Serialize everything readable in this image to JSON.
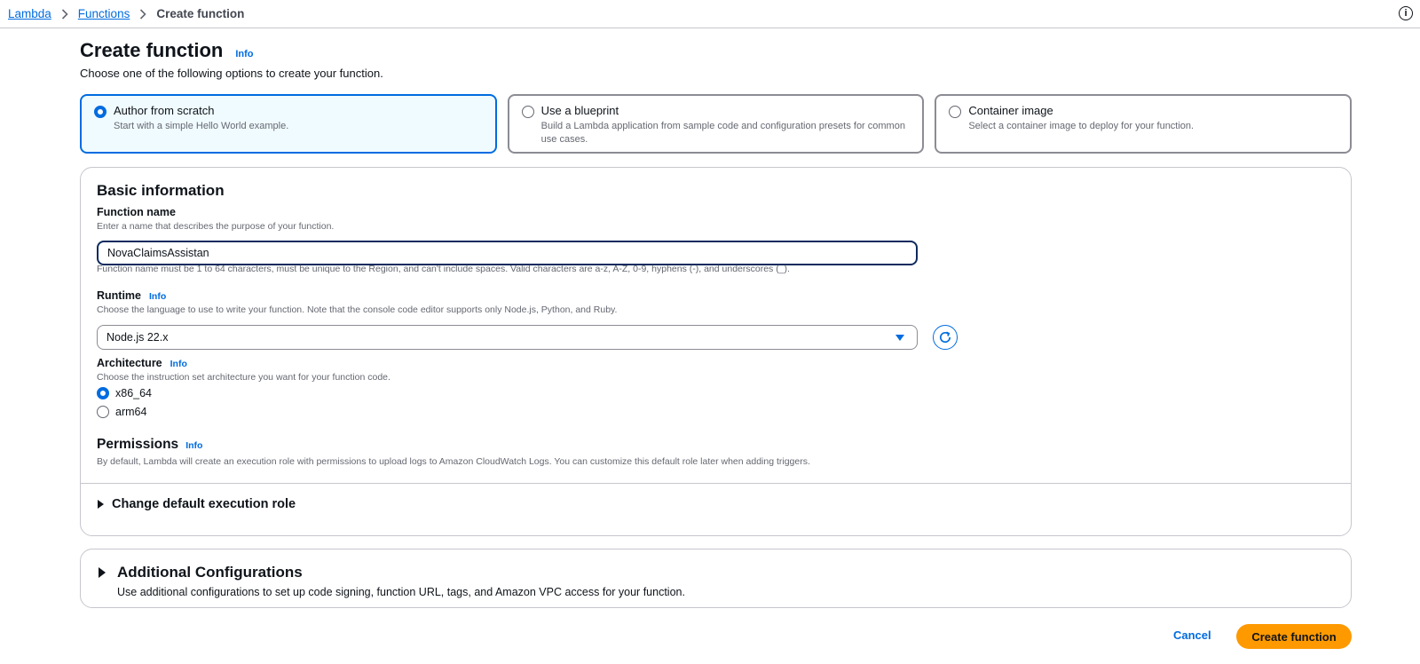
{
  "breadcrumb": {
    "items": [
      "Lambda",
      "Functions"
    ],
    "current": "Create function"
  },
  "header": {
    "title": "Create function",
    "info": "Info",
    "description": "Choose one of the following options to create your function."
  },
  "options": [
    {
      "title": "Author from scratch",
      "description": "Start with a simple Hello World example.",
      "selected": true
    },
    {
      "title": "Use a blueprint",
      "description": "Build a Lambda application from sample code and configuration presets for common use cases.",
      "selected": false
    },
    {
      "title": "Container image",
      "description": "Select a container image to deploy for your function.",
      "selected": false
    }
  ],
  "basic": {
    "title": "Basic information",
    "function_name": {
      "label": "Function name",
      "description": "Enter a name that describes the purpose of your function.",
      "value": "NovaClaimsAssistan",
      "constraint": "Function name must be 1 to 64 characters, must be unique to the Region, and can't include spaces. Valid characters are a-z, A-Z, 0-9, hyphens (-), and underscores (_)."
    },
    "runtime": {
      "label": "Runtime",
      "info": "Info",
      "description": "Choose the language to use to write your function. Note that the console code editor supports only Node.js, Python, and Ruby.",
      "value": "Node.js 22.x"
    },
    "architecture": {
      "label": "Architecture",
      "info": "Info",
      "description": "Choose the instruction set architecture you want for your function code.",
      "options": [
        "x86_64",
        "arm64"
      ],
      "selected": "x86_64"
    },
    "permissions": {
      "title": "Permissions",
      "info": "Info",
      "description": "By default, Lambda will create an execution role with permissions to upload logs to Amazon CloudWatch Logs. You can customize this default role later when adding triggers.",
      "expander": "Change default execution role"
    }
  },
  "additional": {
    "title": "Additional Configurations",
    "description": "Use additional configurations to set up code signing, function URL, tags, and Amazon VPC access for your function."
  },
  "actions": {
    "cancel": "Cancel",
    "create": "Create function"
  },
  "colors": {
    "primary": "#006ce0",
    "accent_button": "#ff9900",
    "selected_tile_bg": "#f0fbff"
  }
}
